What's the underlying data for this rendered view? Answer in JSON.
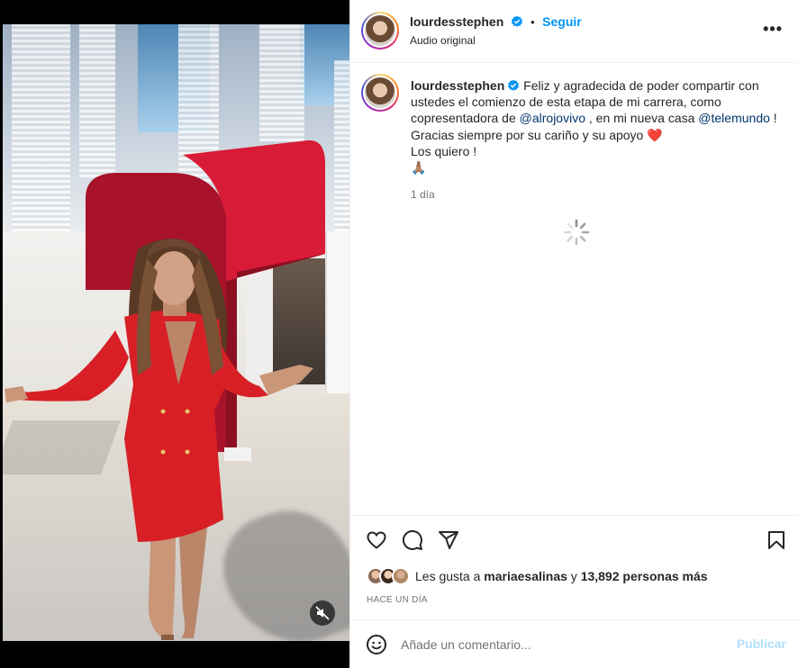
{
  "post": {
    "author": "lourdesstephen",
    "follow_label": "Seguir",
    "separator": "•",
    "audio": "Audio original",
    "more_label": "•••"
  },
  "caption": {
    "author": "lourdesstephen",
    "text_1": "Feliz y agradecida de poder compartir con ustedes el comienzo de esta etapa de mi carrera, como copresentadora de ",
    "mention_1": "@alrojovivo",
    "text_2": " , en mi nueva casa ",
    "mention_2": "@telemundo",
    "text_3": " !",
    "line_2": "Gracias siempre por su cariño y su apoyo ",
    "heart": "❤️",
    "line_3": "Los quiero !",
    "emoji": "🙏🏽",
    "time": "1 día"
  },
  "likes": {
    "prefix": "Les gusta a ",
    "user": "mariaesalinas",
    "mid": " y ",
    "count": "13,892 personas más"
  },
  "timestamp": "HACE UN DÍA",
  "comment": {
    "placeholder": "Añade un comentario...",
    "publish_label": "Publicar"
  },
  "icons": {
    "like": "heart-icon",
    "comment": "comment-icon",
    "share": "share-icon",
    "save": "bookmark-icon",
    "emoji": "emoji-icon",
    "mute": "muted-speaker-icon",
    "more": "more-icon",
    "verified": "verified-badge-icon",
    "loading": "loading-spinner-icon"
  },
  "colors": {
    "accent": "#0095f6",
    "publish_disabled": "#b2dffc",
    "mention": "#00376b",
    "secondary_text": "#737373",
    "dress": "#d81f26",
    "brand_logo": "#c8102e"
  }
}
